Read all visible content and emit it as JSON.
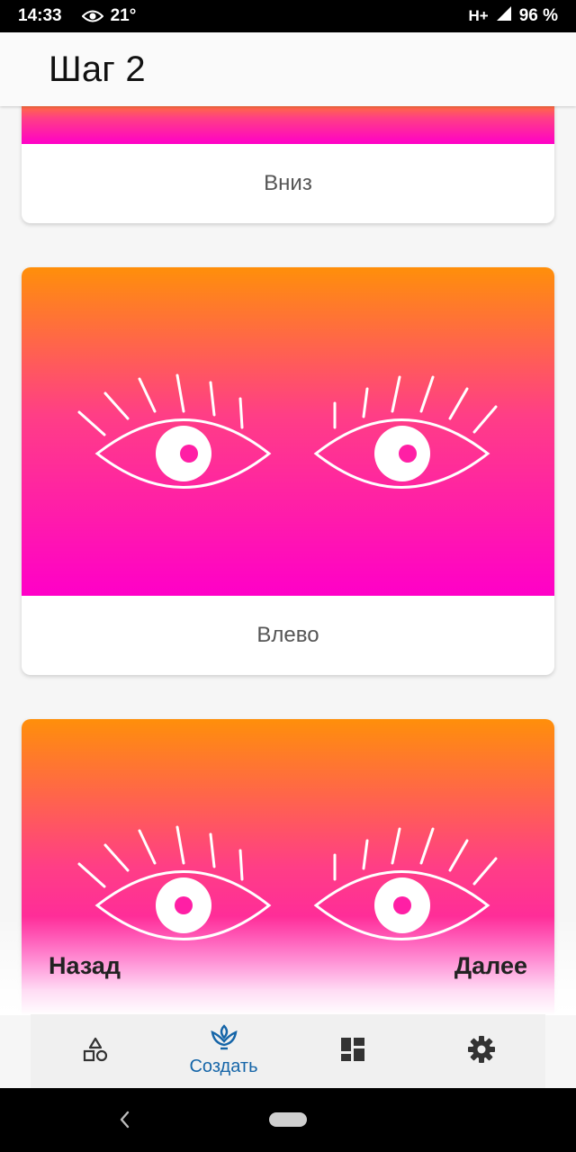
{
  "status_bar": {
    "time": "14:33",
    "temperature": "21°",
    "network": "H+",
    "battery": "96 %",
    "icons": [
      "eye-icon",
      "signal-icon"
    ]
  },
  "app_bar": {
    "title": "Шаг 2"
  },
  "cards": [
    {
      "caption": "Вниз"
    },
    {
      "caption": "Влево"
    },
    {
      "caption": ""
    }
  ],
  "navigation": {
    "back_label": "Назад",
    "next_label": "Далее"
  },
  "bottom_nav": {
    "items": [
      {
        "icon": "shapes-icon",
        "label": ""
      },
      {
        "icon": "sprout-icon",
        "label": "Создать"
      },
      {
        "icon": "dashboard-icon",
        "label": ""
      },
      {
        "icon": "gear-icon",
        "label": ""
      }
    ],
    "active_index": 1
  },
  "colors": {
    "gradient_top": "#ff8f0a",
    "gradient_mid": "#ff3e86",
    "gradient_bottom": "#ff00c8",
    "iris": "#ff1fa5",
    "accent": "#1565a8"
  }
}
